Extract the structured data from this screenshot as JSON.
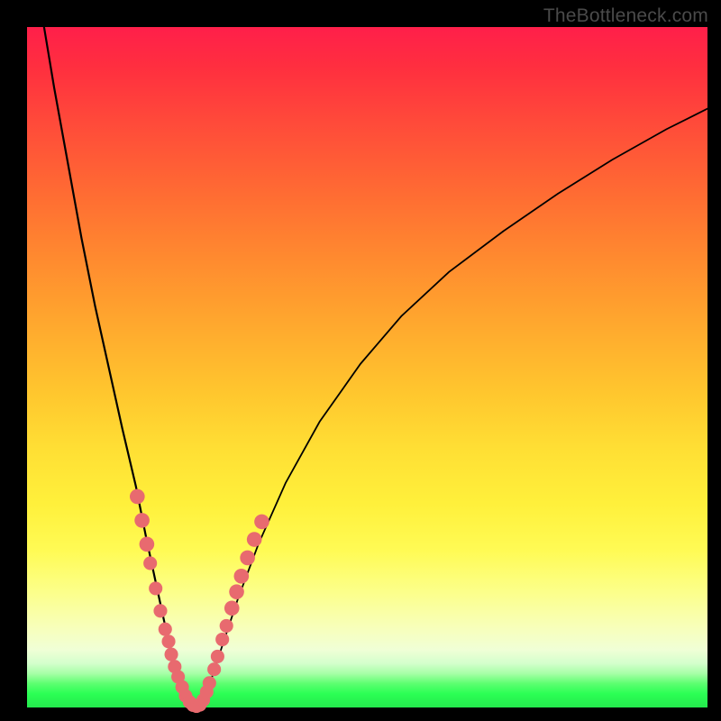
{
  "watermark": {
    "text": "TheBottleneck.com"
  },
  "colors": {
    "frame": "#000000",
    "curve": "#000000",
    "dots": "#e86a6f",
    "gradient_stops": [
      "#ff1f4a",
      "#ff2f3f",
      "#ff4a3a",
      "#ff6a33",
      "#ff8a2f",
      "#ffa92e",
      "#ffc72e",
      "#ffdf34",
      "#fff03b",
      "#fffb55",
      "#fcff8a",
      "#f8ffb8",
      "#f0ffd6",
      "#d4ffcc",
      "#a7ffa7",
      "#5cff70",
      "#2bff54",
      "#24e84d"
    ]
  },
  "chart_data": {
    "type": "line",
    "title": "",
    "xlabel": "",
    "ylabel": "",
    "xlim": [
      0,
      100
    ],
    "ylim": [
      0,
      100
    ],
    "grid": false,
    "legend": false,
    "series": [
      {
        "name": "left-curve",
        "x": [
          2.5,
          4,
          6,
          8,
          10,
          12,
          14,
          16,
          17.5,
          19,
          20.3,
          21.3,
          22.2,
          23,
          23.8
        ],
        "y": [
          100,
          91,
          80,
          69,
          59,
          50,
          41,
          32.5,
          25,
          18,
          12,
          7.5,
          4.2,
          1.8,
          0.3
        ]
      },
      {
        "name": "right-curve",
        "x": [
          25.7,
          26.5,
          27.5,
          29,
          31,
          34,
          38,
          43,
          49,
          55,
          62,
          70,
          78,
          86,
          94,
          100
        ],
        "y": [
          0.3,
          2.2,
          5.5,
          10,
          16,
          24,
          33,
          42,
          50.5,
          57.5,
          64,
          70,
          75.5,
          80.5,
          85,
          88
        ]
      },
      {
        "name": "valley-floor",
        "x": [
          23.8,
          24.3,
          24.8,
          25.3,
          25.7
        ],
        "y": [
          0.3,
          0.1,
          0.05,
          0.1,
          0.3
        ]
      }
    ],
    "annotations_dots": {
      "name": "highlighted-points",
      "color": "#e86a6f",
      "points": [
        {
          "x": 16.2,
          "y": 31.0,
          "r": 1.1
        },
        {
          "x": 16.9,
          "y": 27.5,
          "r": 1.1
        },
        {
          "x": 17.6,
          "y": 24.0,
          "r": 1.1
        },
        {
          "x": 18.1,
          "y": 21.2,
          "r": 1.0
        },
        {
          "x": 18.9,
          "y": 17.5,
          "r": 1.0
        },
        {
          "x": 19.6,
          "y": 14.2,
          "r": 1.0
        },
        {
          "x": 20.3,
          "y": 11.5,
          "r": 1.0
        },
        {
          "x": 20.8,
          "y": 9.7,
          "r": 1.0
        },
        {
          "x": 21.2,
          "y": 7.8,
          "r": 1.0
        },
        {
          "x": 21.7,
          "y": 6.0,
          "r": 1.0
        },
        {
          "x": 22.2,
          "y": 4.5,
          "r": 1.0
        },
        {
          "x": 22.8,
          "y": 3.0,
          "r": 1.0
        },
        {
          "x": 23.3,
          "y": 1.7,
          "r": 1.0
        },
        {
          "x": 23.9,
          "y": 0.8,
          "r": 1.0
        },
        {
          "x": 24.4,
          "y": 0.35,
          "r": 1.0
        },
        {
          "x": 24.9,
          "y": 0.2,
          "r": 1.0
        },
        {
          "x": 25.4,
          "y": 0.4,
          "r": 1.0
        },
        {
          "x": 25.9,
          "y": 1.1,
          "r": 1.0
        },
        {
          "x": 26.4,
          "y": 2.3,
          "r": 1.0
        },
        {
          "x": 26.8,
          "y": 3.6,
          "r": 1.0
        },
        {
          "x": 27.5,
          "y": 5.6,
          "r": 1.0
        },
        {
          "x": 28.0,
          "y": 7.5,
          "r": 1.0
        },
        {
          "x": 28.7,
          "y": 10.0,
          "r": 1.0
        },
        {
          "x": 29.3,
          "y": 12.0,
          "r": 1.0
        },
        {
          "x": 30.1,
          "y": 14.6,
          "r": 1.1
        },
        {
          "x": 30.8,
          "y": 17.0,
          "r": 1.1
        },
        {
          "x": 31.5,
          "y": 19.3,
          "r": 1.1
        },
        {
          "x": 32.4,
          "y": 22.0,
          "r": 1.1
        },
        {
          "x": 33.4,
          "y": 24.7,
          "r": 1.1
        },
        {
          "x": 34.5,
          "y": 27.3,
          "r": 1.1
        }
      ]
    }
  }
}
